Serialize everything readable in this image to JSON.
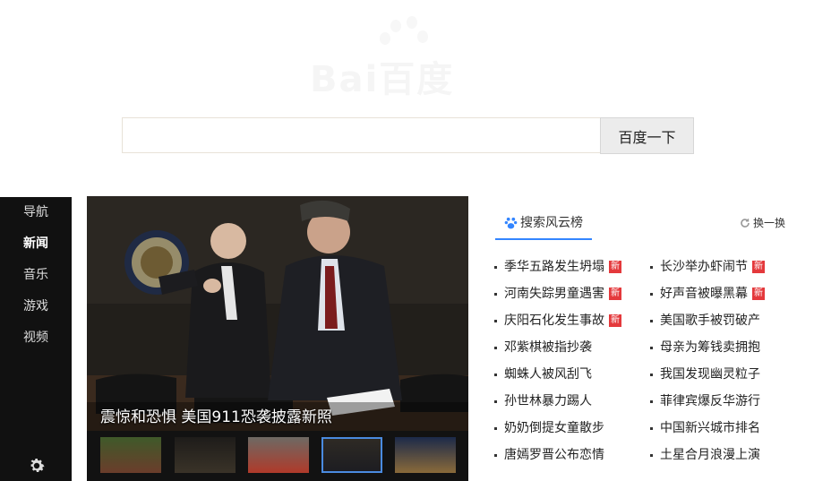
{
  "logo": {
    "text": "Bai",
    "cn": "百度"
  },
  "search": {
    "value": "",
    "placeholder": "",
    "button_label": "百度一下"
  },
  "leftnav": {
    "items": [
      {
        "label": "导航",
        "active": false
      },
      {
        "label": "新闻",
        "active": true
      },
      {
        "label": "音乐",
        "active": false
      },
      {
        "label": "游戏",
        "active": false
      },
      {
        "label": "视频",
        "active": false
      }
    ],
    "settings_icon": "gear-icon"
  },
  "photo": {
    "caption": "震惊和恐惧 美国911恐袭披露新照",
    "selected_thumb": 3,
    "thumb_count": 5
  },
  "hotlist": {
    "title": "搜索风云榜",
    "change_label": "换一换",
    "new_badge": "新",
    "left": [
      {
        "text": "季华五路发生坍塌",
        "new": true
      },
      {
        "text": "河南失踪男童遇害",
        "new": true
      },
      {
        "text": "庆阳石化发生事故",
        "new": true
      },
      {
        "text": "邓紫棋被指抄袭",
        "new": false
      },
      {
        "text": "蜘蛛人被风刮飞",
        "new": false
      },
      {
        "text": "孙世林暴力踢人",
        "new": false
      },
      {
        "text": "奶奶倒提女童散步",
        "new": false
      },
      {
        "text": "唐嫣罗晋公布恋情",
        "new": false
      }
    ],
    "right": [
      {
        "text": "长沙举办虾闹节",
        "new": true
      },
      {
        "text": "好声音被曝黑幕",
        "new": true
      },
      {
        "text": "美国歌手被罚破产",
        "new": false
      },
      {
        "text": "母亲为筹钱卖拥抱",
        "new": false
      },
      {
        "text": "我国发现幽灵粒子",
        "new": false
      },
      {
        "text": "菲律宾爆反华游行",
        "new": false
      },
      {
        "text": "中国新兴城市排名",
        "new": false
      },
      {
        "text": "土星合月浪漫上演",
        "new": false
      }
    ]
  },
  "colors": {
    "accent": "#3385ff",
    "badge": "#e4393c",
    "nav_bg": "#111111"
  }
}
